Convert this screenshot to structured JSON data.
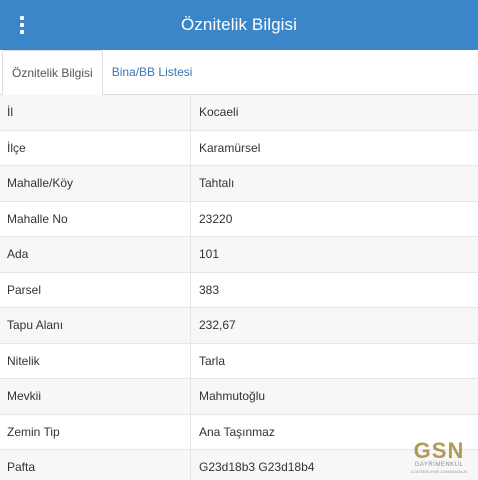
{
  "header": {
    "title": "Öznitelik Bilgisi"
  },
  "tabs": [
    {
      "label": "Öznitelik Bilgisi",
      "active": true
    },
    {
      "label": "Bina/BB Listesi",
      "active": false
    }
  ],
  "attributes": [
    {
      "key": "İl",
      "value": "Kocaeli"
    },
    {
      "key": "İlçe",
      "value": "Karamürsel"
    },
    {
      "key": "Mahalle/Köy",
      "value": "Tahtalı"
    },
    {
      "key": "Mahalle No",
      "value": "23220"
    },
    {
      "key": "Ada",
      "value": "101"
    },
    {
      "key": "Parsel",
      "value": "383"
    },
    {
      "key": "Tapu Alanı",
      "value": "232,67"
    },
    {
      "key": "Nitelik",
      "value": "Tarla"
    },
    {
      "key": "Mevkii",
      "value": "Mahmutoğlu"
    },
    {
      "key": "Zemin Tip",
      "value": "Ana Taşınmaz"
    },
    {
      "key": "Pafta",
      "value": "G23d18b3 G23d18b4"
    }
  ],
  "watermark": {
    "logo": "GSN",
    "line1": "GAYRİMENKUL",
    "line2": "& DEĞERLEME DANIŞMANLIK"
  },
  "colors": {
    "header_bg": "#3a86c8",
    "tab_link": "#337ab7",
    "row_stripe": "#f7f7f7"
  },
  "icons": {
    "menu": "vertical-ellipsis-icon"
  }
}
